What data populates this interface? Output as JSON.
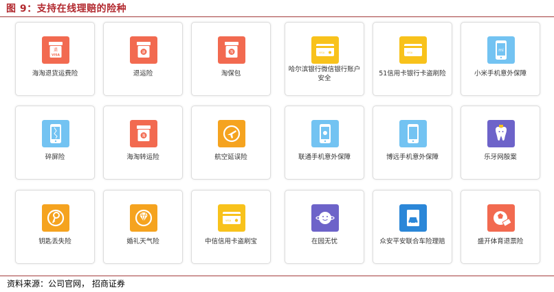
{
  "figure": {
    "title": "图 9：支持在线理赔的险种"
  },
  "source": "资料来源：公司官网， 招商证券",
  "products": [
    {
      "label": "海淘退货运费险",
      "icon": "return-bag-visa-icon",
      "color": "#f26a50"
    },
    {
      "label": "退运险",
      "icon": "return-bag-icon",
      "color": "#f26a50"
    },
    {
      "label": "淘保包",
      "icon": "shopping-bag-icon",
      "color": "#f26a50"
    },
    {
      "label": "哈尔滨银行微信银行账户安全",
      "icon": "bank-card-icon",
      "color": "#f8c21b"
    },
    {
      "label": "51信用卡银行卡盗刷险",
      "icon": "bank-card-icon",
      "color": "#f8c21b"
    },
    {
      "label": "小米手机意外保障",
      "icon": "mi-phone-icon",
      "color": "#73c3f2"
    },
    {
      "label": "碎屏险",
      "icon": "cracked-screen-phone-icon",
      "color": "#73c3f2"
    },
    {
      "label": "海淘转运险",
      "icon": "transfer-bag-icon",
      "color": "#f26a50"
    },
    {
      "label": "航空延误险",
      "icon": "flight-delay-icon",
      "color": "#f5a31f"
    },
    {
      "label": "联通手机意外保障",
      "icon": "phone-icon",
      "color": "#73c3f2"
    },
    {
      "label": "博远手机意外保障",
      "icon": "phone-icon",
      "color": "#73c3f2"
    },
    {
      "label": "乐牙网殷案",
      "icon": "tooth-icon",
      "color": "#6d63c9"
    },
    {
      "label": "钥匙丢失险",
      "icon": "key-icon",
      "color": "#f5a31f"
    },
    {
      "label": "婚礼天气险",
      "icon": "diamond-ring-icon",
      "color": "#f5a31f"
    },
    {
      "label": "中信信用卡盗刷宝",
      "icon": "bank-card-icon",
      "color": "#f8c21b"
    },
    {
      "label": "在园无忧",
      "icon": "face-icon",
      "color": "#6d63c9"
    },
    {
      "label": "众安平安联合车险理赔",
      "icon": "car-document-icon",
      "color": "#2b87d8"
    },
    {
      "label": "盛开体育退票险",
      "icon": "ball-ticket-icon",
      "color": "#f26a50"
    }
  ]
}
